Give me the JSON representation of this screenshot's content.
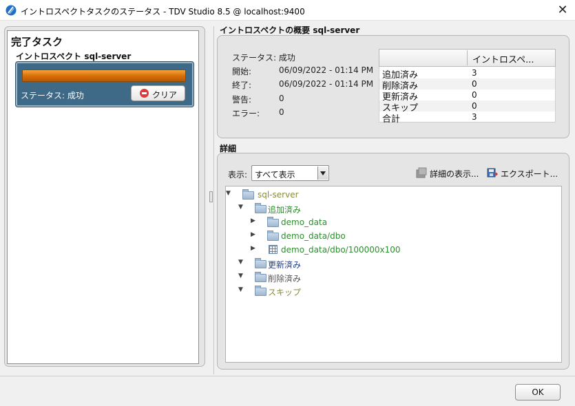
{
  "window": {
    "title": "イントロスペクトタスクのステータス - TDV Studio 8.5 @ localhost:9400",
    "close_glyph": "✕"
  },
  "left": {
    "heading": "完了タスク",
    "task_title": "イントロスペクト sql-server",
    "progress": 1.0,
    "status": "ステータス: 成功",
    "clear_button": "クリア"
  },
  "summary": {
    "title": "イントロスペクトの概要 sql-server",
    "status": "ステータス: 成功",
    "start_label": "開始:",
    "start_value": "06/09/2022 - 01:14 PM",
    "end_label": "終了:",
    "end_value": "06/09/2022 - 01:14 PM",
    "warn_label": "警告:",
    "warn_value": "0",
    "error_label": "エラー:",
    "error_value": "0",
    "table_column": "イントロスペ...",
    "rows": [
      {
        "name": "追加済み",
        "value": "3"
      },
      {
        "name": "削除済み",
        "value": "0"
      },
      {
        "name": "更新済み",
        "value": "0"
      },
      {
        "name": "スキップ",
        "value": "0"
      },
      {
        "name": "合計",
        "value": "3"
      }
    ]
  },
  "details": {
    "title": "詳細",
    "show_label": "表示:",
    "show_value": "すべて表示",
    "details_button": "詳細の表示...",
    "export_button": "エクスポート...",
    "tree": {
      "root": "sql-server",
      "added": "追加済み",
      "added_items": [
        "demo_data",
        "demo_data/dbo",
        "demo_data/dbo/100000x100"
      ],
      "updated": "更新済み",
      "deleted": "削除済み",
      "skipped": "スキップ"
    }
  },
  "footer": {
    "ok": "OK"
  },
  "colors": {
    "root": "#8a8a3a",
    "added": "#2e8b2e",
    "updated": "#1f3f8f",
    "deleted": "#555555",
    "skipped": "#8a8a3a"
  }
}
